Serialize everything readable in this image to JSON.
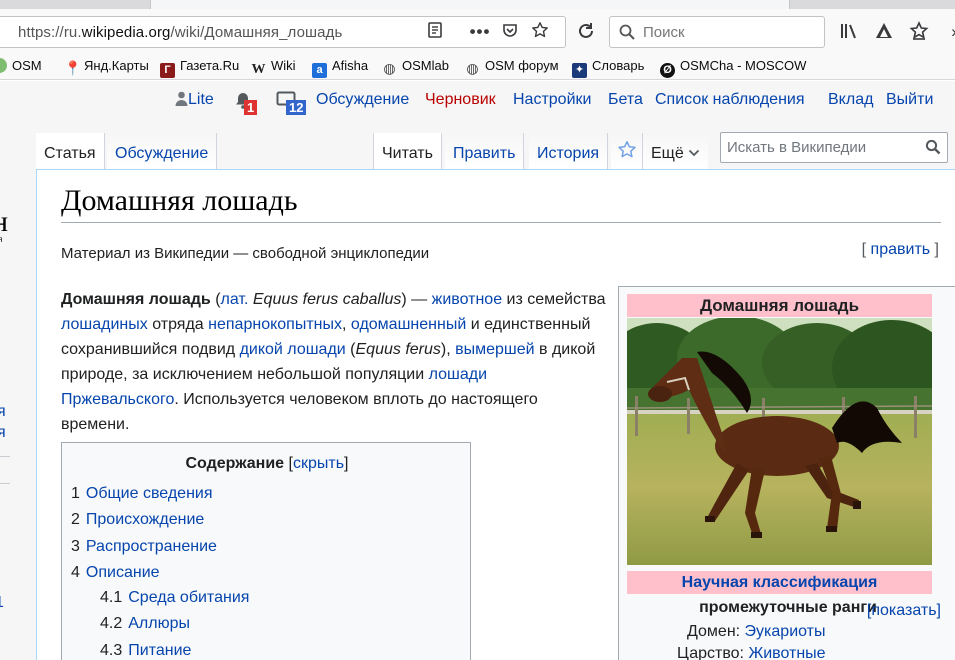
{
  "browser": {
    "url_prefix": "https://ru.",
    "url_domain": "wikipedia.org",
    "url_rest": "/wiki/Домашняя_лошадь",
    "search_placeholder": "Поиск",
    "bookmarks": [
      {
        "label": "OSM",
        "icon": "osm-icon",
        "color": "#7ebc6f"
      },
      {
        "label": "Янд.Карты",
        "icon": "map-pin-icon",
        "color": "#ff3333"
      },
      {
        "label": "Газета.Ru",
        "icon": "gazeta-icon",
        "color": "#8b1a1a"
      },
      {
        "label": "Wiki",
        "icon": "wikipedia-icon",
        "color": "#333333"
      },
      {
        "label": "Afisha",
        "icon": "afisha-icon",
        "color": "#1e6fd9"
      },
      {
        "label": "OSMlab",
        "icon": "globe-icon",
        "color": "#444444"
      },
      {
        "label": "OSM форум",
        "icon": "globe-icon",
        "color": "#444444"
      },
      {
        "label": "Словарь",
        "icon": "dictionary-icon",
        "color": "#1a3a7a"
      },
      {
        "label": "OSMCha - MOSCOW",
        "icon": "osmcha-icon",
        "color": "#111111"
      }
    ]
  },
  "wiki": {
    "personal": {
      "lite": "Lite",
      "notifications_count": "1",
      "messages_count": "12",
      "talk": "Обсуждение",
      "draft": "Черновик",
      "settings": "Настройки",
      "beta": "Бета",
      "watchlist": "Список наблюдения",
      "contributions": "Вклад",
      "logout": "Выйти"
    },
    "left_fragments": [
      "я",
      "я",
      "1"
    ],
    "tabs": {
      "article": "Статья",
      "discussion": "Обсуждение",
      "read": "Читать",
      "edit": "Править",
      "history": "История",
      "more": "Ещё"
    },
    "search_placeholder": "Искать в Википедии",
    "title": "Домашняя лошадь",
    "from": "Материал из Википедии — свободной энциклопедии",
    "edit_link": "править",
    "lead": {
      "bold": "Домашняя лошадь",
      "t1": " (",
      "l1": "лат.",
      "i1": " Equus ferus caballus",
      "t2": ") — ",
      "l2": "животное",
      "t3": " из семейства ",
      "l3": "лошадиных",
      "t4": " отряда ",
      "l4": "непарнокопытных",
      "t5": ", ",
      "l5": "одомашненный",
      "t6": " и единственный сохранившийся подвид ",
      "l6": "дикой лошади",
      "t7": " (",
      "i2": "Equus ferus",
      "t8": "), ",
      "l7": "вымершей",
      "t9": " в дикой природе, за исключением небольшой популяции ",
      "l8": "лошади Пржевальского",
      "t10": ". Используется человеком вплоть до настоящего времени."
    },
    "toc": {
      "title": "Содержание",
      "hide": "скрыть",
      "items": [
        {
          "num": "1",
          "label": "Общие сведения"
        },
        {
          "num": "2",
          "label": "Происхождение"
        },
        {
          "num": "3",
          "label": "Распространение"
        },
        {
          "num": "4",
          "label": "Описание"
        },
        {
          "num": "4.1",
          "label": "Среда обитания"
        },
        {
          "num": "4.2",
          "label": "Аллюры"
        },
        {
          "num": "4.3",
          "label": "Питание"
        }
      ]
    },
    "infobox": {
      "title": "Домашняя лошадь",
      "classification": "Научная классификация",
      "ranks": "промежуточные ранги",
      "show": "показать",
      "domain_label": "Домен:",
      "domain_value": "Эукариоты",
      "kingdom_label": "Царство:",
      "kingdom_value": "Животные"
    }
  },
  "colors": {
    "link": "#0645ad",
    "redlink": "#ba0000",
    "infobox_header": "#ffc0cb",
    "badge_red": "#d33",
    "badge_blue": "#36c"
  }
}
